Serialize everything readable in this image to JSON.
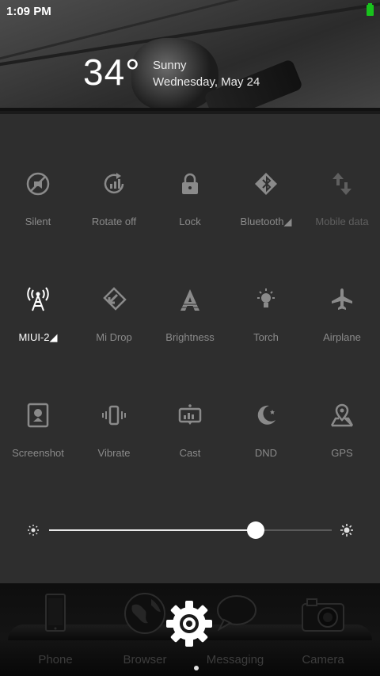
{
  "status": {
    "time": "1:09 PM"
  },
  "weather": {
    "temperature": "34°",
    "condition": "Sunny",
    "date": "Wednesday, May 24"
  },
  "toggles": [
    {
      "label": "Silent",
      "icon": "silent-icon",
      "state": "off"
    },
    {
      "label": "Rotate off",
      "icon": "rotate-icon",
      "state": "off"
    },
    {
      "label": "Lock",
      "icon": "lock-icon",
      "state": "off"
    },
    {
      "label": "Bluetooth◢",
      "icon": "bluetooth-icon",
      "state": "off"
    },
    {
      "label": "Mobile data",
      "icon": "mobile-data-icon",
      "state": "disabled"
    },
    {
      "label": "MIUI-2◢",
      "icon": "wifi-tower-icon",
      "state": "on"
    },
    {
      "label": "Mi Drop",
      "icon": "mi-drop-icon",
      "state": "off"
    },
    {
      "label": "Brightness",
      "icon": "brightness-icon",
      "state": "off"
    },
    {
      "label": "Torch",
      "icon": "torch-icon",
      "state": "off"
    },
    {
      "label": "Airplane",
      "icon": "airplane-icon",
      "state": "off"
    },
    {
      "label": "Screenshot",
      "icon": "screenshot-icon",
      "state": "off"
    },
    {
      "label": "Vibrate",
      "icon": "vibrate-icon",
      "state": "off"
    },
    {
      "label": "Cast",
      "icon": "cast-icon",
      "state": "off"
    },
    {
      "label": "DND",
      "icon": "dnd-icon",
      "state": "off"
    },
    {
      "label": "GPS",
      "icon": "gps-icon",
      "state": "off"
    }
  ],
  "brightness": {
    "level": 0.73
  },
  "dock": [
    {
      "label": "Phone",
      "icon": "phone-icon"
    },
    {
      "label": "Browser",
      "icon": "browser-icon"
    },
    {
      "label": "Messaging",
      "icon": "messaging-icon"
    },
    {
      "label": "Camera",
      "icon": "camera-icon"
    }
  ],
  "colors": {
    "battery": "#18c21c",
    "panel": "#2e2e2e",
    "active_label": "#ffffff"
  }
}
